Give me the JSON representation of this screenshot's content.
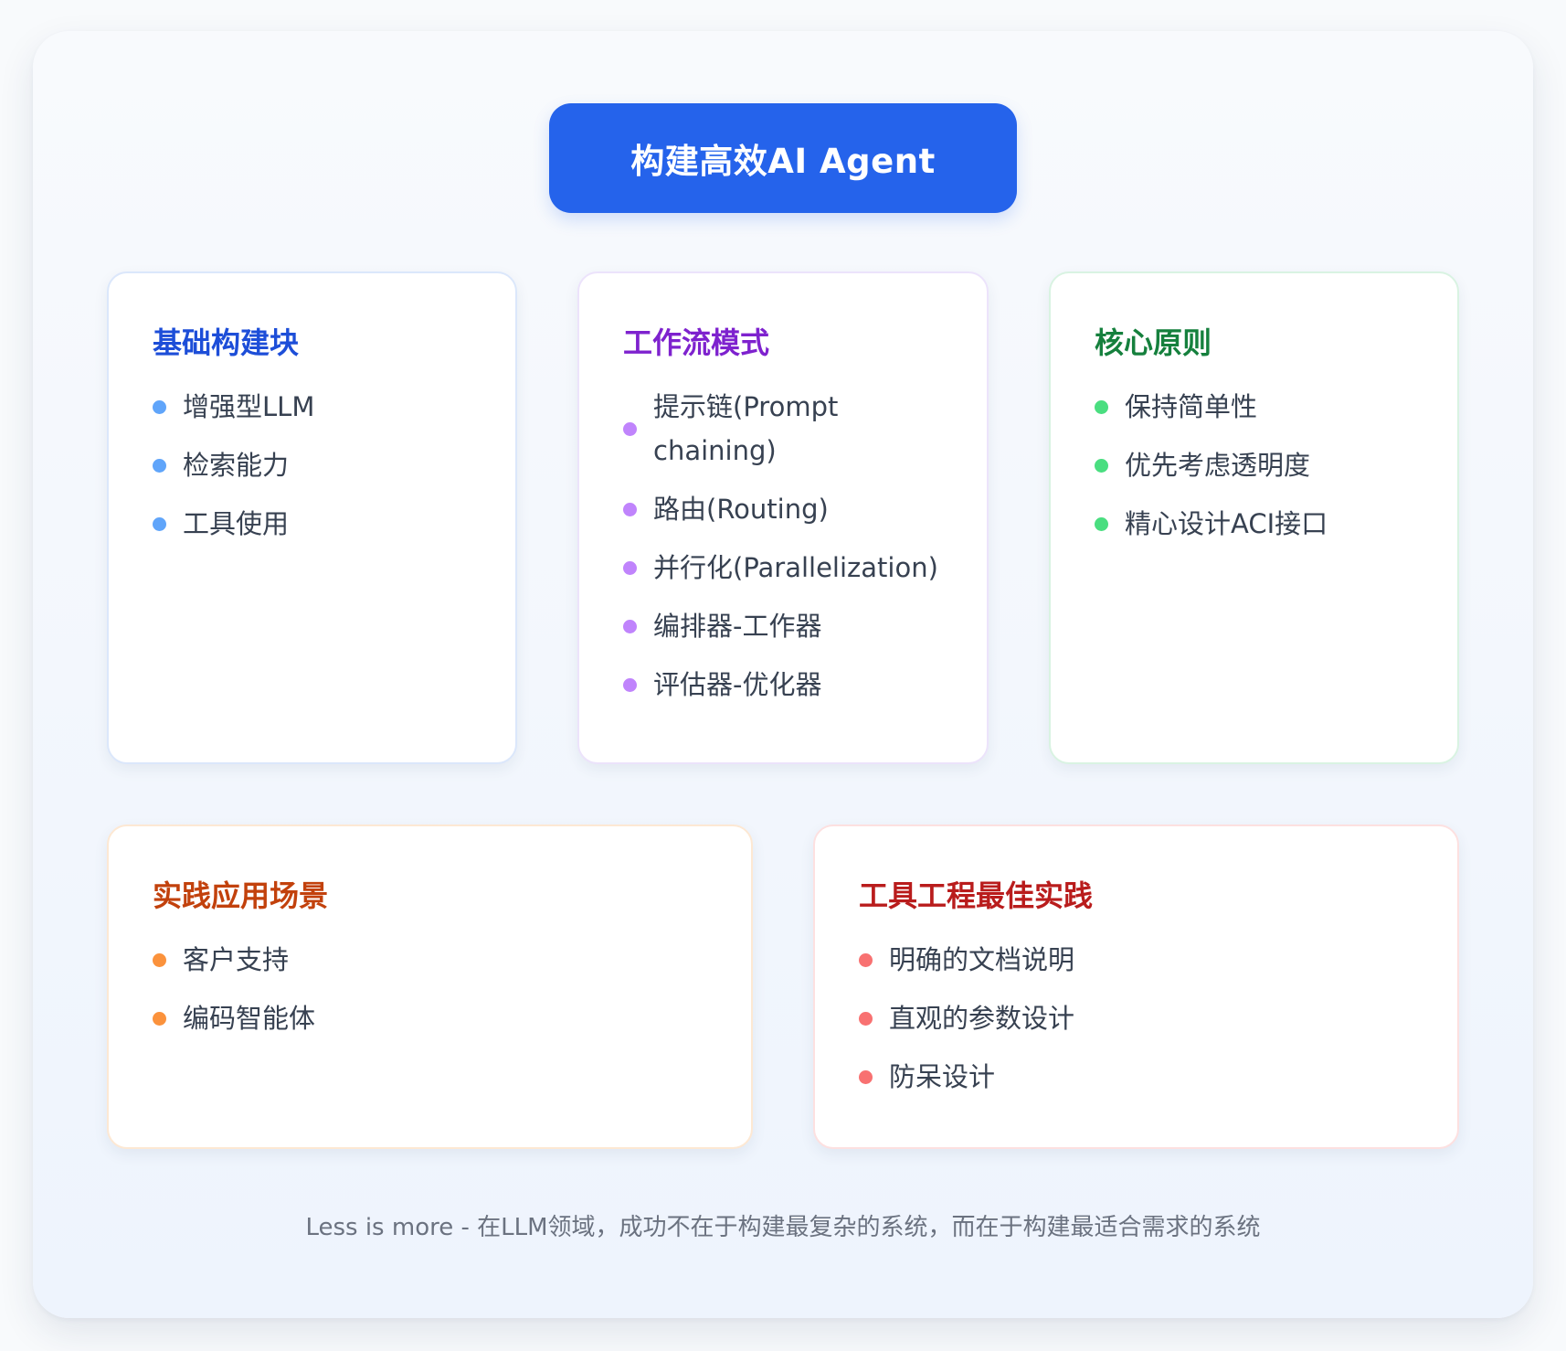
{
  "title": "构建高效AI Agent",
  "cards": [
    {
      "heading": "基础构建块",
      "color": "#1d4ed8",
      "bullet_color": "#60a5fa",
      "border_color": "#dbe7fb",
      "items": [
        "增强型LLM",
        "检索能力",
        "工具使用"
      ]
    },
    {
      "heading": "工作流模式",
      "color": "#7e22ce",
      "bullet_color": "#c084fc",
      "border_color": "#ece3fb",
      "items": [
        "提示链(Prompt chaining)",
        "路由(Routing)",
        "并行化(Parallelization)",
        "编排器-工作器",
        "评估器-优化器"
      ]
    },
    {
      "heading": "核心原则",
      "color": "#15803d",
      "bullet_color": "#4ade80",
      "border_color": "#d9f3e2",
      "items": [
        "保持简单性",
        "优先考虑透明度",
        "精心设计ACI接口"
      ]
    },
    {
      "heading": "实践应用场景",
      "color": "#c2410c",
      "bullet_color": "#fb923c",
      "border_color": "#fde8d3",
      "items": [
        "客户支持",
        "编码智能体"
      ]
    },
    {
      "heading": "工具工程最佳实践",
      "color": "#b91c1c",
      "bullet_color": "#f87171",
      "border_color": "#fde0e0",
      "items": [
        "明确的文档说明",
        "直观的参数设计",
        "防呆设计"
      ]
    }
  ],
  "footer": "Less is more - 在LLM领域，成功不在于构建最复杂的系统，而在于构建最适合需求的系统"
}
